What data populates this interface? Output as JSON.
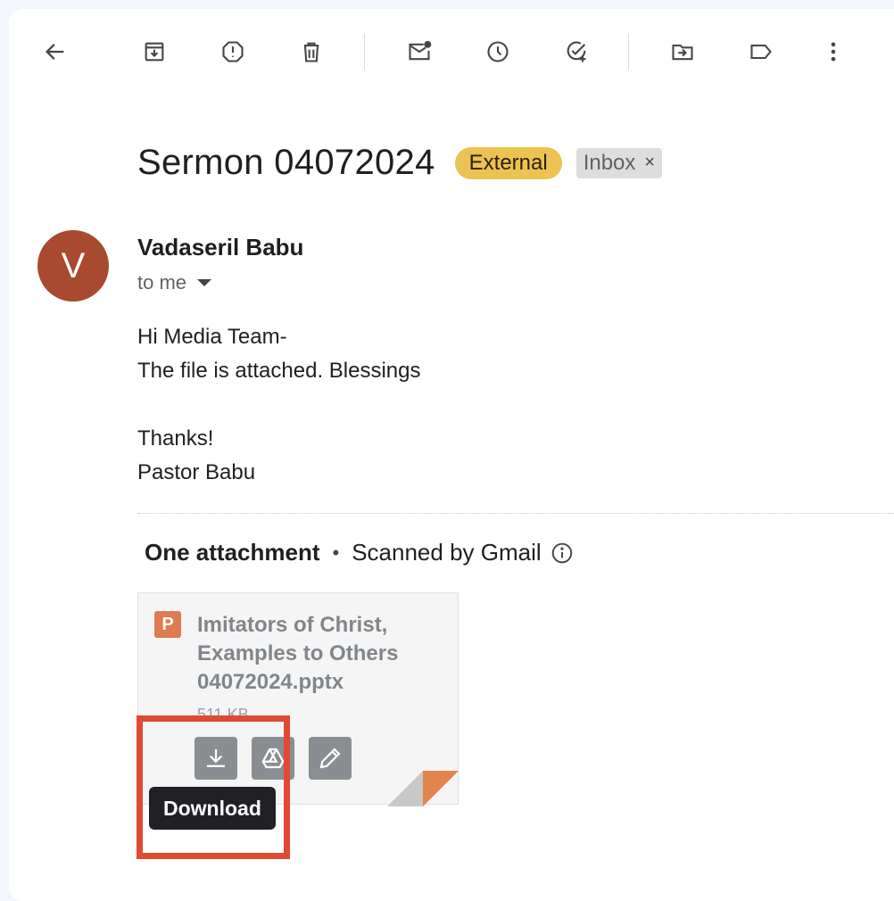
{
  "toolbar": {
    "back": "back-arrow-icon",
    "archive": "archive-icon",
    "spam": "report-spam-icon",
    "delete": "delete-icon",
    "unread": "mark-unread-icon",
    "snooze": "snooze-icon",
    "task": "add-to-tasks-icon",
    "move": "move-to-icon",
    "label": "label-icon",
    "more": "more-vert-icon"
  },
  "email": {
    "subject": "Sermon 04072024",
    "badges": {
      "external": "External",
      "inbox": "Inbox",
      "inbox_remove": "×"
    },
    "sender": {
      "initial": "V",
      "name": "Vadaseril Babu",
      "recipient": "to me"
    },
    "body_lines": [
      "Hi Media Team-",
      "The file is attached. Blessings",
      "",
      "Thanks!",
      "Pastor Babu"
    ]
  },
  "attachments": {
    "count_label": "One attachment",
    "bullet": "•",
    "scan_label": "Scanned by Gmail",
    "file": {
      "type_letter": "P",
      "name_lines": [
        "Imitators of Christ,",
        "Examples to Others",
        "04072024.pptx"
      ],
      "size": "511 KB"
    },
    "tooltip": "Download"
  },
  "colors": {
    "external_badge": "#ecc253",
    "avatar": "#a84a2f",
    "highlight": "#e04a33",
    "pptx": "#e07a50"
  }
}
